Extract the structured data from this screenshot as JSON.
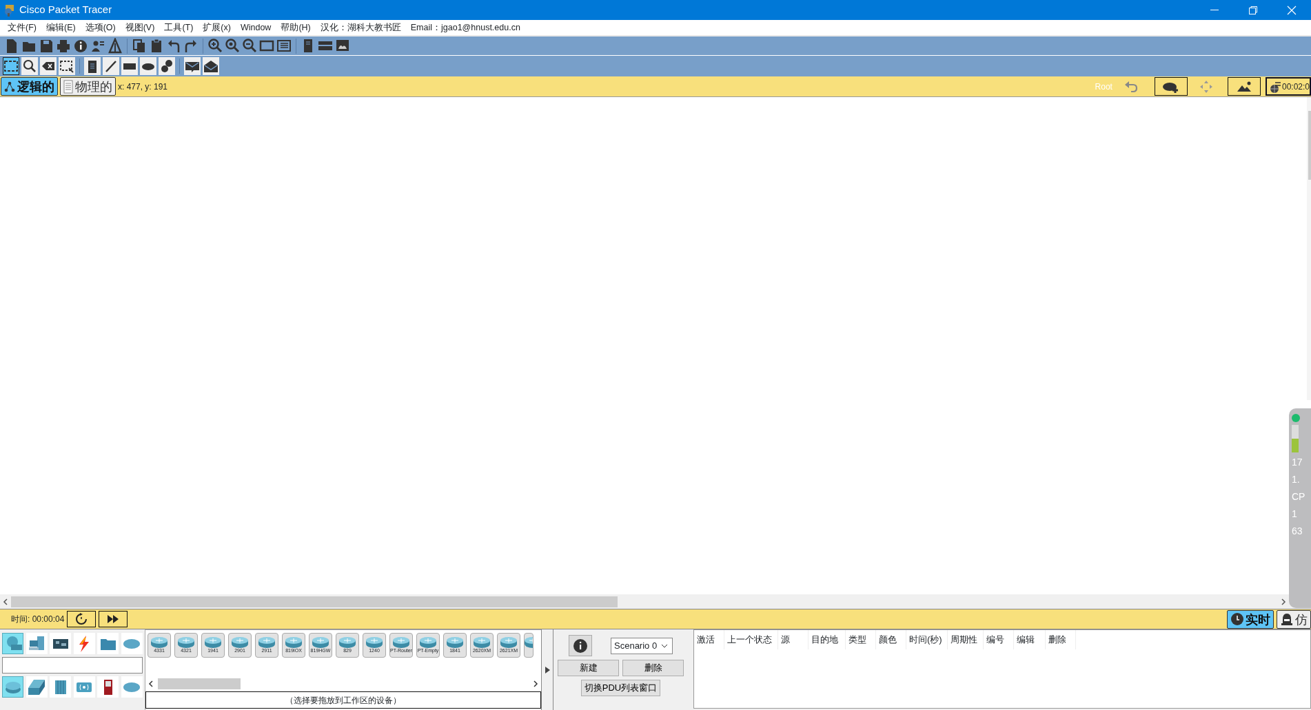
{
  "window": {
    "title": "Cisco Packet Tracer"
  },
  "menu": [
    "文件(F)",
    "编辑(E)",
    "选项(O)",
    "视图(V)",
    "工具(T)",
    "扩展(x)",
    "Window",
    "帮助(H)",
    "汉化：湖科大教书匠",
    "Email：jgao1@hnust.edu.cn"
  ],
  "tools": [
    {
      "selected": true
    },
    {
      "selected": false
    },
    {
      "selected": false
    },
    {
      "selected": false
    },
    {
      "selected": false
    },
    {
      "selected": false
    },
    {
      "selected": false
    },
    {
      "selected": false
    },
    {
      "selected": false
    },
    {
      "selected": false
    },
    {
      "selected": false
    }
  ],
  "workspace_tabs": [
    {
      "label": "逻辑的",
      "selected": true
    },
    {
      "label": "物理的",
      "selected": false
    }
  ],
  "cursor_position": "x: 477, y: 191",
  "breadcrumb": "Root",
  "clock": "00:02:0",
  "overlay_widget": {
    "readings": [
      "17",
      "1.",
      "CP",
      "1",
      "63"
    ]
  },
  "time_bar": {
    "label": "时间: 00:00:04"
  },
  "modes": [
    {
      "label": "实时",
      "selected": true
    },
    {
      "label": "仿",
      "selected": false
    }
  ],
  "device_categories": [
    {
      "selected": true
    },
    {
      "selected": false
    },
    {
      "selected": false
    },
    {
      "selected": false
    },
    {
      "selected": false
    },
    {
      "selected": false
    }
  ],
  "device_subcategories": [
    {
      "selected": true
    },
    {
      "selected": false
    },
    {
      "selected": false
    },
    {
      "selected": false
    },
    {
      "selected": false
    },
    {
      "selected": false
    }
  ],
  "device_models": [
    "4331",
    "4321",
    "1941",
    "2901",
    "2911",
    "819IOX",
    "819HGW",
    "829",
    "1240",
    "PT-Router",
    "PT-Empty",
    "1841",
    "2620XM",
    "2621XM"
  ],
  "device_hint": "（选择要拖放到工作区的设备）",
  "scenario": {
    "value": "Scenario 0"
  },
  "pdu_buttons": [
    "新建",
    "删除"
  ],
  "toggle_button": "切换PDU列表窗口",
  "pdu_table": {
    "columns": [
      "激活",
      "上一个状态",
      "源",
      "目的地",
      "类型",
      "颜色",
      "时间(秒)",
      "周期性",
      "编号",
      "编辑",
      "删除"
    ]
  }
}
